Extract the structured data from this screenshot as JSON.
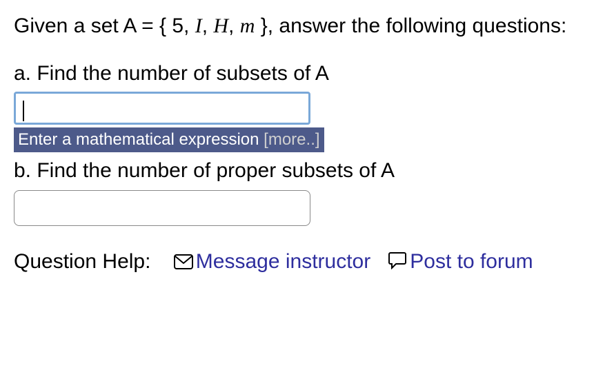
{
  "prompt": {
    "prefix": "Given a set A = { 5, ",
    "var1": "I",
    "sep1": ", ",
    "var2": "H",
    "sep2": ", ",
    "var3": "m",
    "suffix": " }, answer the following questions:"
  },
  "part_a": {
    "label": "a. Find the number of subsets of A",
    "value": "",
    "hint_text": "Enter a mathematical expression ",
    "hint_more": "[more..]"
  },
  "part_b": {
    "label": "b. Find the number of proper subsets of A",
    "value": ""
  },
  "help": {
    "label": "Question Help:",
    "message_link": "Message instructor",
    "post_link": "Post to forum"
  }
}
